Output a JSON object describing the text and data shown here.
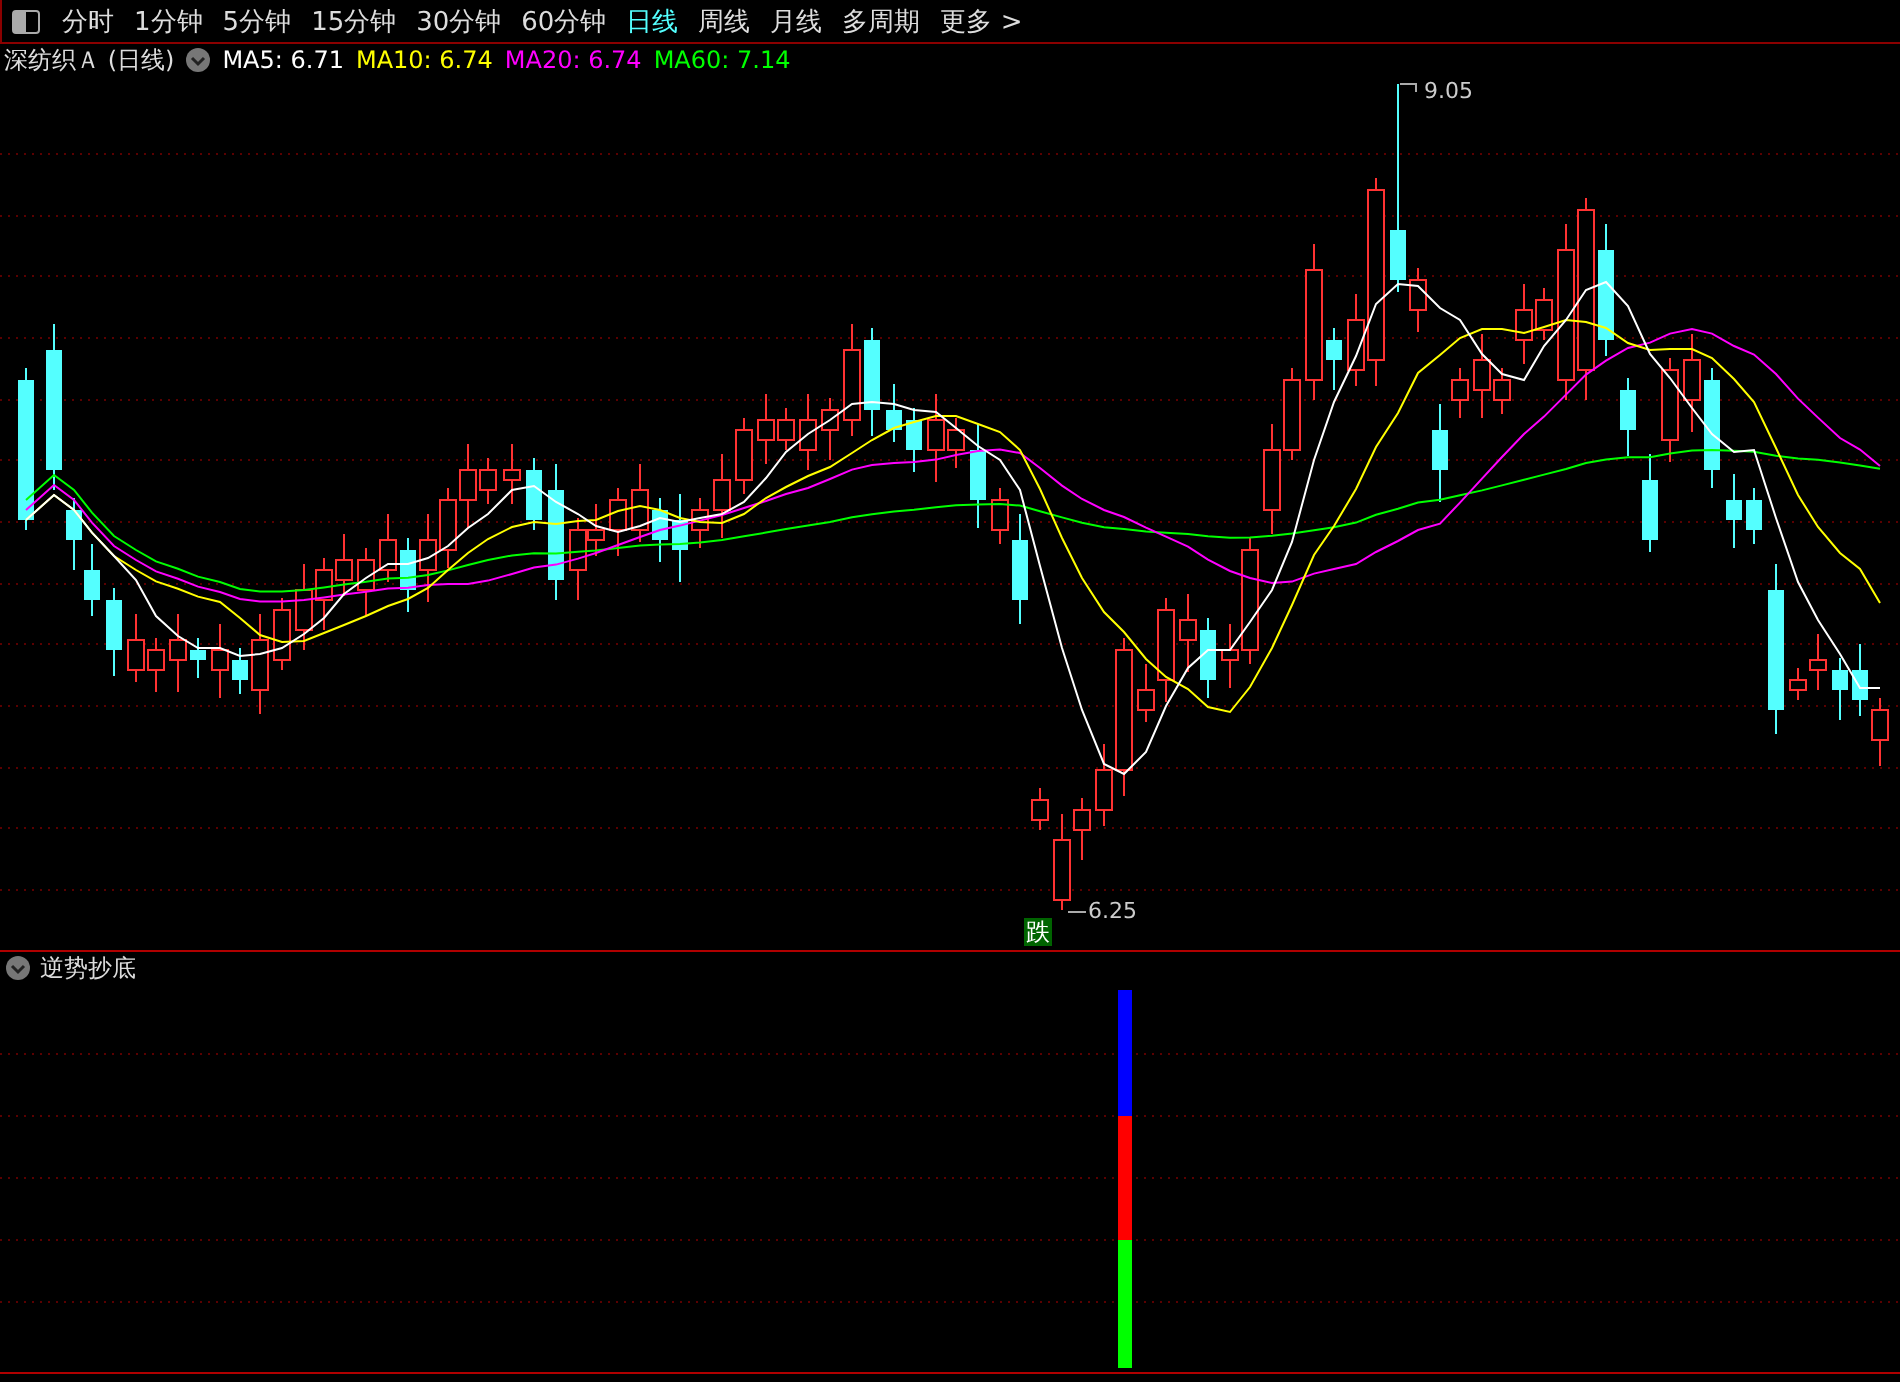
{
  "toolbar": {
    "tabs": [
      {
        "label": "分时",
        "selected": false
      },
      {
        "label": "1分钟",
        "selected": false
      },
      {
        "label": "5分钟",
        "selected": false
      },
      {
        "label": "15分钟",
        "selected": false
      },
      {
        "label": "30分钟",
        "selected": false
      },
      {
        "label": "60分钟",
        "selected": false
      },
      {
        "label": "日线",
        "selected": true
      },
      {
        "label": "周线",
        "selected": false
      },
      {
        "label": "月线",
        "selected": false
      },
      {
        "label": "多周期",
        "selected": false
      },
      {
        "label": "更多 >",
        "selected": false
      }
    ]
  },
  "main_chart": {
    "title": "深纺织Ａ (日线)",
    "indicators": [
      {
        "text": "MA5: 6.71",
        "color": "#ffffff"
      },
      {
        "text": "MA10: 6.74",
        "color": "#ffff00"
      },
      {
        "text": "MA20: 6.74",
        "color": "#ff00ff"
      },
      {
        "text": "MA60: 7.14",
        "color": "#00ff00"
      }
    ],
    "high_label": "9.05",
    "low_label": "6.25",
    "signal_badge": "跌"
  },
  "indicator_panel": {
    "title": "逆势抄底"
  }
}
